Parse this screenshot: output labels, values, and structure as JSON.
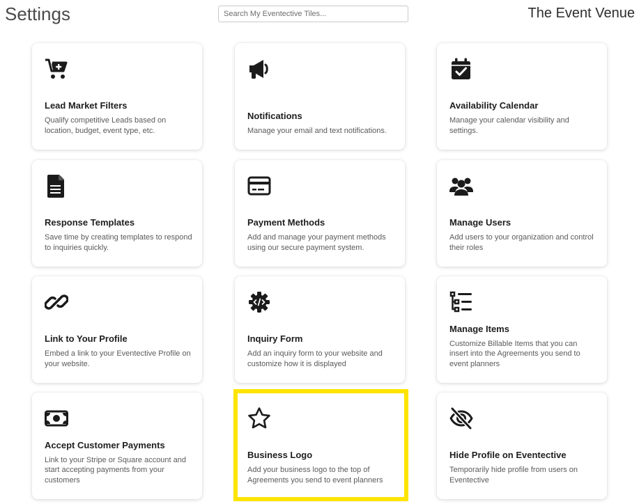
{
  "header": {
    "title": "Settings",
    "search_placeholder": "Search My Eventective Tiles...",
    "venue_name": "The Event Venue"
  },
  "tiles": [
    {
      "icon": "cart-plus-icon",
      "title": "Lead Market Filters",
      "desc": "Qualify competitive Leads based on location, budget, event type, etc."
    },
    {
      "icon": "megaphone-icon",
      "title": "Notifications",
      "desc": "Manage your email and text notifications."
    },
    {
      "icon": "calendar-check-icon",
      "title": "Availability Calendar",
      "desc": "Manage your calendar visibility and settings."
    },
    {
      "icon": "document-icon",
      "title": "Response Templates",
      "desc": "Save time by creating templates to respond to inquiries quickly."
    },
    {
      "icon": "credit-card-icon",
      "title": "Payment Methods",
      "desc": "Add and manage your payment methods using our secure payment system."
    },
    {
      "icon": "users-icon",
      "title": "Manage Users",
      "desc": "Add users to your organization and control their roles"
    },
    {
      "icon": "link-icon",
      "title": "Link to Your Profile",
      "desc": "Embed a link to your Eventective Profile on your website."
    },
    {
      "icon": "code-gear-icon",
      "title": "Inquiry Form",
      "desc": "Add an inquiry form to your website and customize how it is displayed"
    },
    {
      "icon": "list-tree-icon",
      "title": "Manage Items",
      "desc": "Customize Billable Items that you can insert into the Agreements you send to event planners"
    },
    {
      "icon": "money-bill-icon",
      "title": "Accept Customer Payments",
      "desc": "Link to your Stripe or Square account and start accepting payments from your customers"
    },
    {
      "icon": "star-icon",
      "title": "Business Logo",
      "desc": "Add your business logo to the top of Agreements you send to event planners"
    },
    {
      "icon": "eye-slash-icon",
      "title": "Hide Profile on Eventective",
      "desc": "Temporarily hide profile from users on Eventective"
    }
  ],
  "highlight_color": "#ffe400"
}
